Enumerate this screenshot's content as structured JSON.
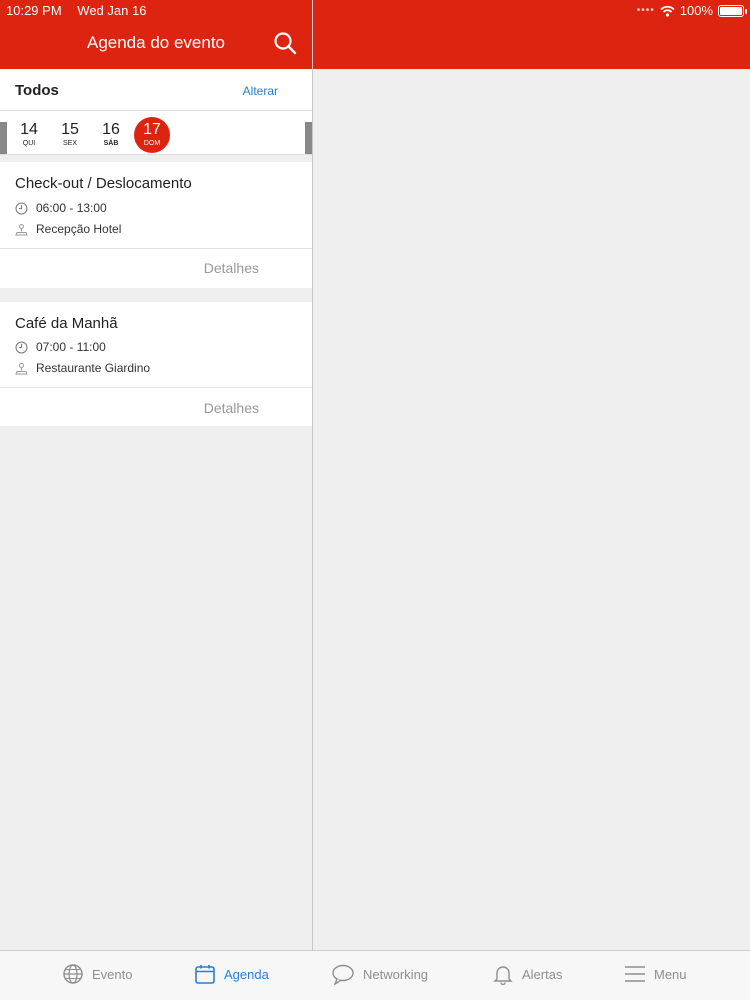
{
  "status": {
    "time": "10:29 PM",
    "date": "Wed Jan 16",
    "battery": "100%"
  },
  "header": {
    "title": "Agenda do evento"
  },
  "filter": {
    "title": "Todos",
    "change_label": "Alterar"
  },
  "dates": [
    {
      "num": "14",
      "day": "QUI"
    },
    {
      "num": "15",
      "day": "SEX"
    },
    {
      "num": "16",
      "day": "SÁB"
    },
    {
      "num": "17",
      "day": "DOM",
      "selected": true
    }
  ],
  "events": [
    {
      "title": "Check-out / Deslocamento",
      "time": "06:00 - 13:00",
      "location": "Recepção Hotel",
      "details_label": "Detalhes"
    },
    {
      "title": "Café da Manhã",
      "time": "07:00 - 11:00",
      "location": "Restaurante Giardino",
      "details_label": "Detalhes"
    }
  ],
  "tabs": [
    {
      "label": "Evento",
      "icon": "globe-icon"
    },
    {
      "label": "Agenda",
      "icon": "calendar-icon",
      "active": true
    },
    {
      "label": "Networking",
      "icon": "chat-bubble-icon"
    },
    {
      "label": "Alertas",
      "icon": "bell-icon"
    },
    {
      "label": "Menu",
      "icon": "hamburger-icon"
    }
  ],
  "colors": {
    "brand": "#dc2410",
    "accent": "#2a7fd4",
    "muted": "#8e8e8e"
  }
}
